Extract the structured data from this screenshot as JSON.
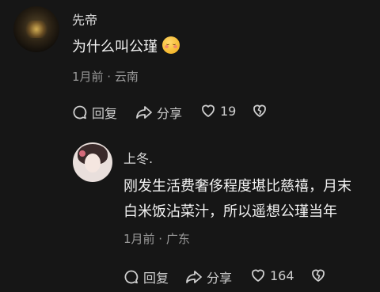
{
  "comment1": {
    "username": "先帝",
    "text": "为什么叫公瑾",
    "emoji": "kissing-face-emoji",
    "meta": "1月前 · 云南",
    "actions": {
      "reply": "回复",
      "share": "分享",
      "likes": "19"
    }
  },
  "comment2": {
    "username": "上冬.",
    "line1": "刚发生活费奢侈程度堪比慈禧，月末",
    "line2": "白米饭沾菜汁，所以遥想公瑾当年",
    "meta": "1月前 · 广东",
    "actions": {
      "reply": "回复",
      "share": "分享",
      "likes": "164"
    }
  }
}
